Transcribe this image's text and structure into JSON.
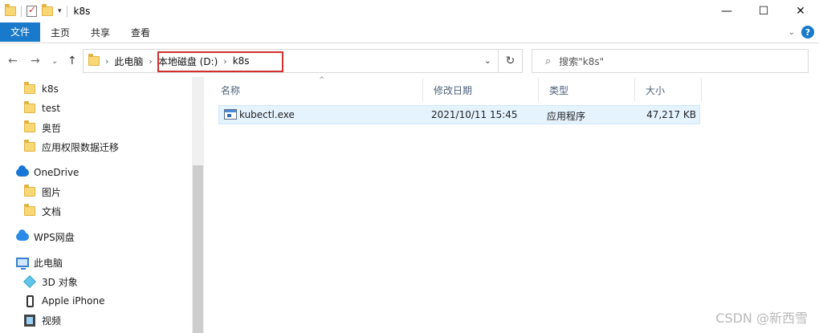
{
  "window": {
    "title": "k8s"
  },
  "ribbon": {
    "tabs": [
      {
        "label": "文件"
      },
      {
        "label": "主页"
      },
      {
        "label": "共享"
      },
      {
        "label": "查看"
      }
    ]
  },
  "address": {
    "crumbs": [
      "此电脑",
      "本地磁盘 (D:)",
      "k8s"
    ]
  },
  "search": {
    "placeholder": "搜索\"k8s\""
  },
  "sidebar": {
    "items": [
      {
        "label": "k8s",
        "icon": "folder-icon"
      },
      {
        "label": "test",
        "icon": "folder-icon"
      },
      {
        "label": "奥哲",
        "icon": "folder-icon"
      },
      {
        "label": "应用权限数据迁移",
        "icon": "folder-icon"
      },
      {
        "label": "OneDrive",
        "icon": "onedrive-icon"
      },
      {
        "label": "图片",
        "icon": "folder-icon"
      },
      {
        "label": "文档",
        "icon": "folder-icon"
      },
      {
        "label": "WPS网盘",
        "icon": "wps-cloud-icon"
      },
      {
        "label": "此电脑",
        "icon": "computer-icon"
      },
      {
        "label": "3D 对象",
        "icon": "cube-icon"
      },
      {
        "label": "Apple iPhone",
        "icon": "phone-icon"
      },
      {
        "label": "视频",
        "icon": "video-icon"
      }
    ]
  },
  "columns": [
    "名称",
    "修改日期",
    "类型",
    "大小"
  ],
  "files": [
    {
      "name": "kubectl.exe",
      "modified": "2021/10/11 15:45",
      "type": "应用程序",
      "size": "47,217 KB"
    }
  ],
  "watermark": "CSDN @新西雪",
  "colors": {
    "accent": "#1979ca",
    "highlight_box": "#d22f2f",
    "selection": "#e5f3ff"
  }
}
